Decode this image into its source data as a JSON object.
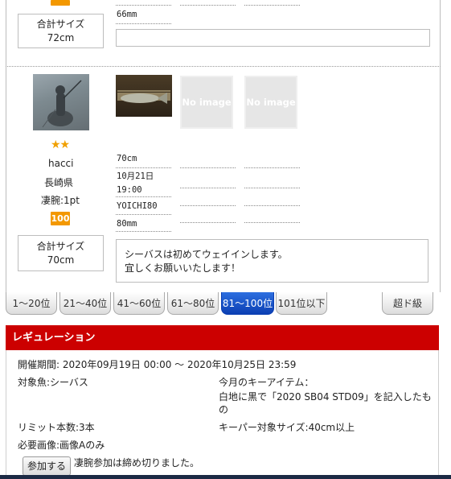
{
  "entry1": {
    "caught_at": "66mm",
    "total_size_label": "合計サイズ",
    "total_size_value": "72cm",
    "badge": "",
    "comment": ""
  },
  "entry2": {
    "stars": "★★",
    "user": "hacci",
    "prefecture": "長崎県",
    "points": "凄腕:1pt",
    "badge": "100",
    "no_image_1": "No image",
    "no_image_2": "No image",
    "size": "70cm",
    "date": "10月21日",
    "time": "19:00",
    "lure": "YOICHI80",
    "lure_size": "80mm",
    "total_size_label": "合計サイズ",
    "total_size_value": "70cm",
    "comment_line1": "シーバスは初めてウェイインします。",
    "comment_line2": "宜しくお願いいたします！"
  },
  "tabs": [
    {
      "label": "1〜20位",
      "active": false
    },
    {
      "label": "21〜40位",
      "active": false
    },
    {
      "label": "41〜60位",
      "active": false
    },
    {
      "label": "61〜80位",
      "active": false
    },
    {
      "label": "81〜100位",
      "active": true
    },
    {
      "label": "101位以下",
      "active": false
    }
  ],
  "big_button": "超ド級",
  "regulation": {
    "title": "レギュレーション",
    "period": "開催期間: 2020年09月19日 00:00 〜 2020年10月25日 23:59",
    "target_fish": "対象魚:シーバス",
    "key_item_label": "今月のキーアイテム：",
    "key_item_line1": "白地に黒で「2020 SB04 STD09」を記入したも",
    "key_item_line2": "の",
    "limit": "リミット本数:3本",
    "keeper_size": "キーパー対象サイズ:40cm以上",
    "required_image": "必要画像:画像Aのみ",
    "join_button": "参加する",
    "closed_text": "凄腕参加は締め切りました。"
  },
  "colors": {
    "accent_red": "#cc0000",
    "badge_orange": "#f39800",
    "active_tab": "#0c3fb3"
  }
}
